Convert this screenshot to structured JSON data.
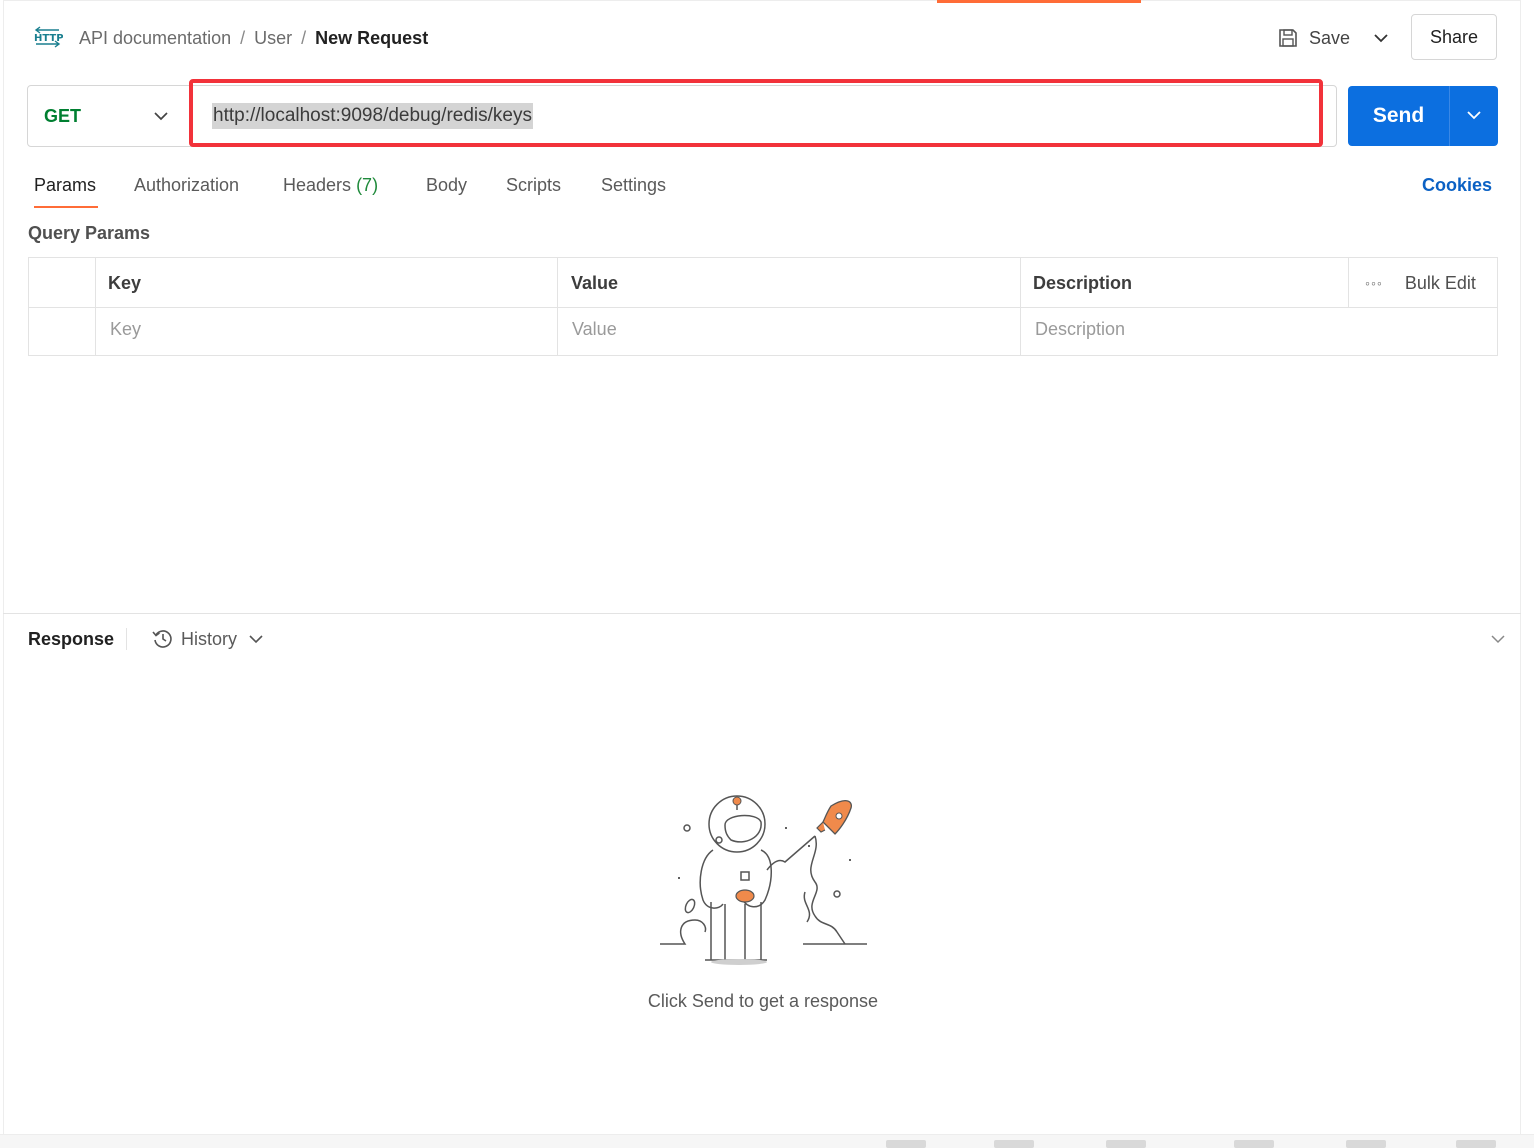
{
  "header": {
    "breadcrumb": [
      "API documentation",
      "User",
      "New Request"
    ],
    "save_label": "Save",
    "share_label": "Share"
  },
  "request": {
    "method": "GET",
    "url": "http://localhost:9098/debug/redis/keys",
    "send_label": "Send"
  },
  "tabs": [
    {
      "label": "Params",
      "active": true
    },
    {
      "label": "Authorization"
    },
    {
      "label": "Headers",
      "count": "(7)"
    },
    {
      "label": "Body"
    },
    {
      "label": "Scripts"
    },
    {
      "label": "Settings"
    }
  ],
  "cookies_label": "Cookies",
  "params": {
    "title": "Query Params",
    "columns": [
      "Key",
      "Value",
      "Description"
    ],
    "placeholders": [
      "Key",
      "Value",
      "Description"
    ],
    "bulk_edit_label": "Bulk Edit"
  },
  "response": {
    "title": "Response",
    "history_label": "History",
    "empty_message": "Click Send to get a response"
  },
  "colors": {
    "accent": "#ff6c37",
    "send": "#0c6fe0",
    "method_get": "#007f31",
    "highlight": "#f2323a",
    "link": "#0b61c4"
  }
}
